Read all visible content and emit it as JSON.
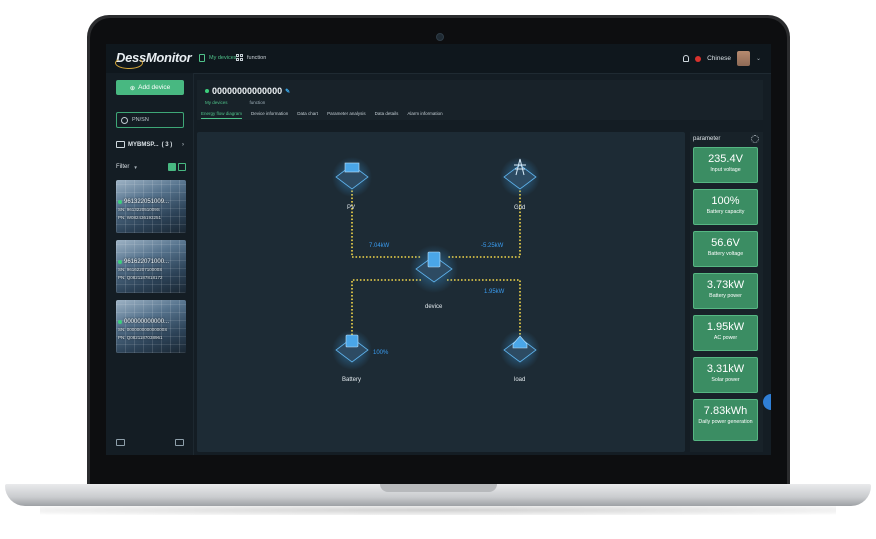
{
  "app": {
    "logo": "DessMonitor"
  },
  "topbar": {
    "my_devices_label": "My devices",
    "function_label": "function",
    "language": "Chinese"
  },
  "sidebar": {
    "add_device_label": "Add device",
    "search_placeholder": "PN/SN",
    "group_name": "MYBMSP...",
    "group_count": "( 3 )",
    "filter_label": "Filter",
    "devices": [
      {
        "title": "961322051009...",
        "sn": "SN: 961322051009S",
        "pn": "PN: W082436193251"
      },
      {
        "title": "961622071000...",
        "sn": "SN: 9616220710000S",
        "pn": "PN: Q0821187818172"
      },
      {
        "title": "000000000000...",
        "sn": "SN: 000000000000000S",
        "pn": "PN: Q0821187038961"
      }
    ]
  },
  "device": {
    "id": "00000000000000",
    "meta": [
      "My devices",
      "function"
    ],
    "tabs": [
      "Energy flow diagram",
      "Device information",
      "Data chart",
      "Parameter analysis",
      "Data details",
      "Alarm information"
    ],
    "active_tab": 0
  },
  "flow": {
    "nodes": {
      "pv": "PV",
      "grid": "Grid",
      "device": "device",
      "battery": "Battery",
      "load": "load"
    },
    "pv_power": "7.04kW",
    "grid_power": "-5.25kW",
    "load_power": "1.95kW",
    "battery_percent": "100%"
  },
  "parameter": {
    "title": "parameter",
    "items": [
      {
        "value": "235.4V",
        "label": "Input voltage"
      },
      {
        "value": "100%",
        "label": "Battery capacity"
      },
      {
        "value": "56.6V",
        "label": "Battery voltage"
      },
      {
        "value": "3.73kW",
        "label": "Battery power"
      },
      {
        "value": "1.95kW",
        "label": "AC power"
      },
      {
        "value": "3.31kW",
        "label": "Solar power"
      },
      {
        "value": "7.83kWh",
        "label": "Daily power generation"
      }
    ]
  },
  "colors": {
    "accent": "#48b881",
    "flow_line": "#f1d64a",
    "value_blue": "#3a9cf0",
    "background": "#141d24"
  }
}
